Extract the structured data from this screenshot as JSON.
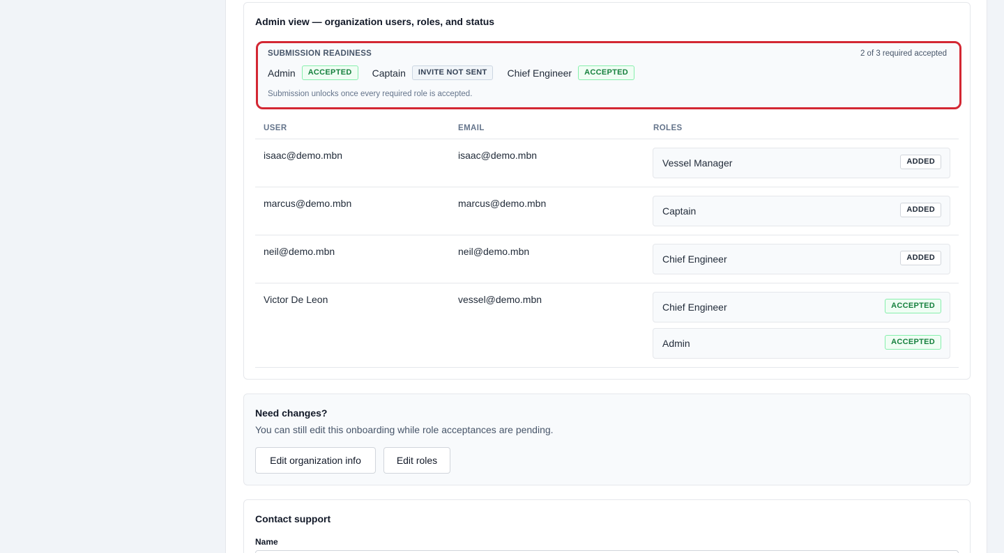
{
  "admin_card": {
    "title": "Admin view — organization users, roles, and status",
    "readiness": {
      "heading": "SUBMISSION READINESS",
      "count": "2 of 3 required accepted",
      "roles": [
        {
          "name": "Admin",
          "status": "ACCEPTED"
        },
        {
          "name": "Captain",
          "status": "INVITE NOT SENT"
        },
        {
          "name": "Chief Engineer",
          "status": "ACCEPTED"
        }
      ],
      "note": "Submission unlocks once every required role is accepted."
    },
    "table": {
      "headers": {
        "user": "USER",
        "email": "EMAIL",
        "roles": "ROLES"
      },
      "rows": [
        {
          "user": "isaac@demo.mbn",
          "email": "isaac@demo.mbn",
          "roles": [
            {
              "name": "Vessel Manager",
              "status": "ADDED"
            }
          ]
        },
        {
          "user": "marcus@demo.mbn",
          "email": "marcus@demo.mbn",
          "roles": [
            {
              "name": "Captain",
              "status": "ADDED"
            }
          ]
        },
        {
          "user": "neil@demo.mbn",
          "email": "neil@demo.mbn",
          "roles": [
            {
              "name": "Chief Engineer",
              "status": "ADDED"
            }
          ]
        },
        {
          "user": "Victor De Leon",
          "email": "vessel@demo.mbn",
          "roles": [
            {
              "name": "Chief Engineer",
              "status": "ACCEPTED"
            },
            {
              "name": "Admin",
              "status": "ACCEPTED"
            }
          ]
        }
      ]
    }
  },
  "changes_card": {
    "title": "Need changes?",
    "description": "You can still edit this onboarding while role acceptances are pending.",
    "edit_org_label": "Edit organization info",
    "edit_roles_label": "Edit roles"
  },
  "support_card": {
    "title": "Contact support",
    "name_label": "Name",
    "name_value": "",
    "name_placeholder": ""
  },
  "colors": {
    "highlight_border": "#d32733",
    "accepted_text": "#15803d",
    "accepted_bg": "#f0fdf4",
    "page_bg": "#f1f4f8"
  }
}
